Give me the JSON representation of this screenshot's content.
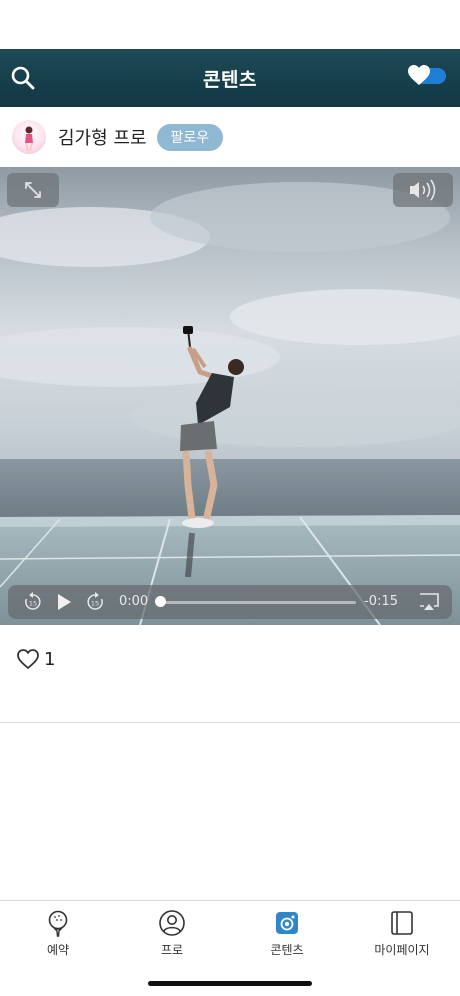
{
  "header": {
    "title": "콘텐츠",
    "toggle_on": true,
    "accent_color": "#1f7fd6"
  },
  "profile": {
    "name": "김가형 프로",
    "follow_label": "팔로우"
  },
  "video": {
    "current_time": "0:00",
    "remaining_time": "-0:15",
    "skip_back_seconds": "15",
    "skip_forward_seconds": "15",
    "progress": 0
  },
  "likes": {
    "count": "1"
  },
  "tabbar": {
    "items": [
      {
        "label": "예약",
        "icon": "golf-ball-tee-icon",
        "active": false
      },
      {
        "label": "프로",
        "icon": "person-icon",
        "active": false
      },
      {
        "label": "콘텐츠",
        "icon": "content-icon",
        "active": true
      },
      {
        "label": "마이페이지",
        "icon": "book-icon",
        "active": false
      }
    ]
  }
}
